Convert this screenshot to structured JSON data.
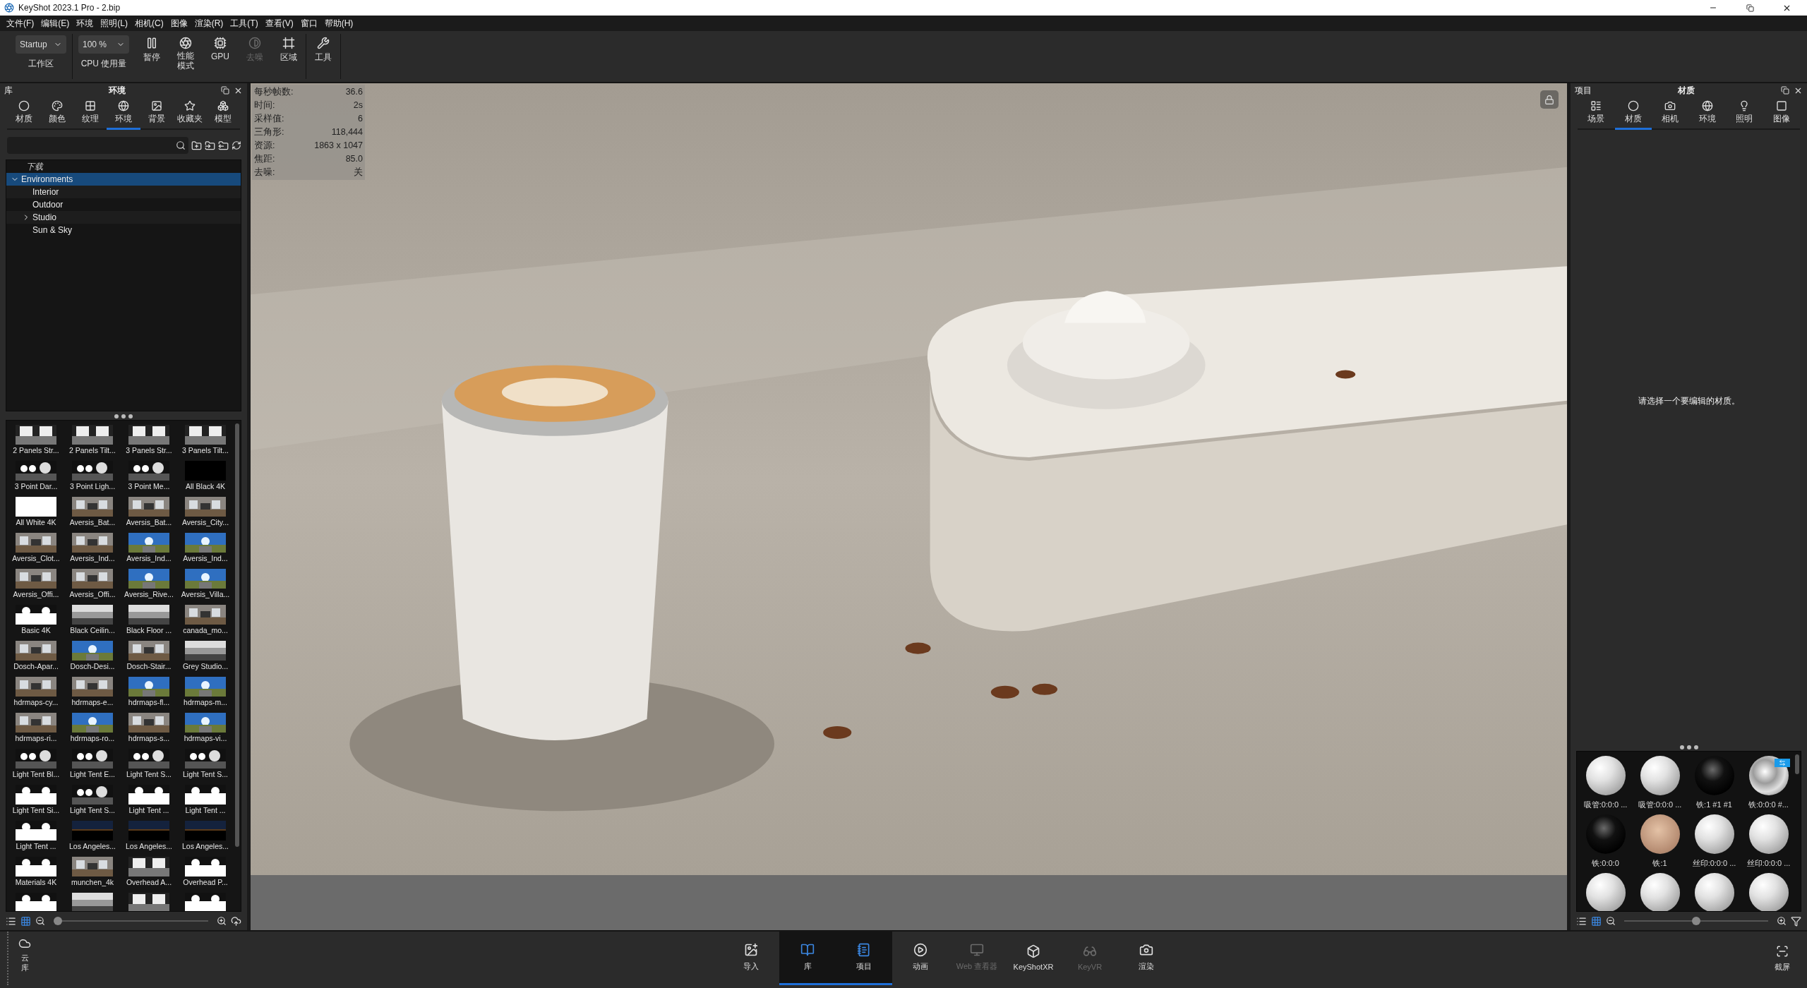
{
  "window": {
    "title": "KeyShot 2023.1 Pro  - 2.bip"
  },
  "menu": [
    "文件(F)",
    "编辑(E)",
    "环境",
    "照明(L)",
    "相机(C)",
    "图像",
    "渲染(R)",
    "工具(T)",
    "查看(V)",
    "窗口",
    "帮助(H)"
  ],
  "toolbar": [
    {
      "kind": "dropdown",
      "value": "Startup",
      "label": "工作区"
    },
    {
      "kind": "dropdown",
      "value": "100 %",
      "label": "CPU 使用量"
    },
    {
      "kind": "button",
      "label": "暂停",
      "disabled": false
    },
    {
      "kind": "button",
      "label": "性能模式",
      "disabled": false
    },
    {
      "kind": "button",
      "label": "GPU",
      "disabled": false
    },
    {
      "kind": "button",
      "label": "去噪",
      "disabled": true
    },
    {
      "kind": "button",
      "label": "区域",
      "disabled": false
    },
    {
      "kind": "button",
      "label": "工具",
      "disabled": false
    }
  ],
  "library": {
    "title": "库",
    "subtitle": "环境",
    "tabs": [
      {
        "label": "材质",
        "selected": false
      },
      {
        "label": "颜色",
        "selected": false
      },
      {
        "label": "纹理",
        "selected": false
      },
      {
        "label": "环境",
        "selected": true
      },
      {
        "label": "背景",
        "selected": false
      },
      {
        "label": "收藏夹",
        "selected": false
      },
      {
        "label": "模型",
        "selected": false
      }
    ],
    "tree_header": "下载",
    "tree": [
      {
        "label": "Environments",
        "selected": true,
        "expanded": true,
        "children": [
          {
            "label": "Interior",
            "selected": false
          },
          {
            "label": "Outdoor",
            "selected": false
          },
          {
            "label": "Studio",
            "selected": false,
            "expanded": false
          },
          {
            "label": "Sun & Sky",
            "selected": false
          }
        ]
      }
    ],
    "thumbnails": [
      {
        "label": "2 Panels Str...",
        "kind": "panels"
      },
      {
        "label": "2 Panels Tilt...",
        "kind": "panels"
      },
      {
        "label": "3 Panels Str...",
        "kind": "panels"
      },
      {
        "label": "3 Panels Tilt...",
        "kind": "panels"
      },
      {
        "label": "3 Point Dar...",
        "kind": "spots"
      },
      {
        "label": "3 Point Ligh...",
        "kind": "spots"
      },
      {
        "label": "3 Point Me...",
        "kind": "spots"
      },
      {
        "label": "All Black 4K",
        "kind": "black"
      },
      {
        "label": "All White 4K",
        "kind": "white"
      },
      {
        "label": "Aversis_Bat...",
        "kind": "interior"
      },
      {
        "label": "Aversis_Bat...",
        "kind": "interior"
      },
      {
        "label": "Aversis_City...",
        "kind": "interior"
      },
      {
        "label": "Aversis_Clot...",
        "kind": "interior"
      },
      {
        "label": "Aversis_Ind...",
        "kind": "interior"
      },
      {
        "label": "Aversis_Ind...",
        "kind": "outdoor"
      },
      {
        "label": "Aversis_Ind...",
        "kind": "outdoor"
      },
      {
        "label": "Aversis_Offi...",
        "kind": "interior"
      },
      {
        "label": "Aversis_Offi...",
        "kind": "interior"
      },
      {
        "label": "Aversis_Rive...",
        "kind": "outdoor"
      },
      {
        "label": "Aversis_Villa...",
        "kind": "outdoor"
      },
      {
        "label": "Basic 4K",
        "kind": "tent"
      },
      {
        "label": "Black Ceilin...",
        "kind": "gradient"
      },
      {
        "label": "Black Floor ...",
        "kind": "gradient"
      },
      {
        "label": "canada_mo...",
        "kind": "interior"
      },
      {
        "label": "Dosch-Apar...",
        "kind": "interior"
      },
      {
        "label": "Dosch-Desi...",
        "kind": "outdoor"
      },
      {
        "label": "Dosch-Stair...",
        "kind": "interior"
      },
      {
        "label": "Grey Studio...",
        "kind": "gradient"
      },
      {
        "label": "hdrmaps-cy...",
        "kind": "interior"
      },
      {
        "label": "hdrmaps-e...",
        "kind": "interior"
      },
      {
        "label": "hdrmaps-fl...",
        "kind": "outdoor"
      },
      {
        "label": "hdrmaps-m...",
        "kind": "outdoor"
      },
      {
        "label": "hdrmaps-ri...",
        "kind": "interior"
      },
      {
        "label": "hdrmaps-ro...",
        "kind": "outdoor"
      },
      {
        "label": "hdrmaps-s...",
        "kind": "interior"
      },
      {
        "label": "hdrmaps-vi...",
        "kind": "outdoor"
      },
      {
        "label": "Light Tent Bl...",
        "kind": "spots"
      },
      {
        "label": "Light Tent E...",
        "kind": "spots"
      },
      {
        "label": "Light Tent S...",
        "kind": "spots"
      },
      {
        "label": "Light Tent S...",
        "kind": "spots"
      },
      {
        "label": "Light Tent Si...",
        "kind": "tent"
      },
      {
        "label": "Light Tent S...",
        "kind": "spots"
      },
      {
        "label": "Light Tent ...",
        "kind": "tent"
      },
      {
        "label": "Light Tent ...",
        "kind": "tent"
      },
      {
        "label": "Light Tent ...",
        "kind": "tent"
      },
      {
        "label": "Los Angeles...",
        "kind": "night"
      },
      {
        "label": "Los Angeles...",
        "kind": "night"
      },
      {
        "label": "Los Angeles...",
        "kind": "night"
      },
      {
        "label": "Materials 4K",
        "kind": "tent"
      },
      {
        "label": "munchen_4k",
        "kind": "interior"
      },
      {
        "label": "Overhead A...",
        "kind": "panels"
      },
      {
        "label": "Overhead P...",
        "kind": "tent"
      },
      {
        "kind": "tent"
      },
      {
        "kind": "gradient"
      },
      {
        "kind": "panels"
      },
      {
        "kind": "tent"
      }
    ],
    "zoom_slider": {
      "level": 0
    }
  },
  "viewport": {
    "stats": [
      {
        "label": "每秒帧数:",
        "value": "36.6"
      },
      {
        "label": "时间:",
        "value": "2s"
      },
      {
        "label": "采样值:",
        "value": "6"
      },
      {
        "label": "三角形:",
        "value": "118,444"
      },
      {
        "label": "资源:",
        "value": "1863 x 1047"
      },
      {
        "label": "焦距:",
        "value": "85.0"
      },
      {
        "label": "去噪:",
        "value": "关"
      }
    ]
  },
  "project": {
    "title": "项目",
    "subtitle": "材质",
    "tabs": [
      {
        "label": "场景",
        "selected": false
      },
      {
        "label": "材质",
        "selected": true
      },
      {
        "label": "相机",
        "selected": false
      },
      {
        "label": "环境",
        "selected": false
      },
      {
        "label": "照明",
        "selected": false
      },
      {
        "label": "图像",
        "selected": false
      }
    ],
    "message": "请选择一个要编辑的材质。",
    "materials": [
      {
        "label": "吸管:0:0:0 ...",
        "kind": "white",
        "linked": false
      },
      {
        "label": "吸管:0:0:0 ...",
        "kind": "white",
        "linked": false
      },
      {
        "label": "铁:1 #1 #1",
        "kind": "black",
        "linked": false
      },
      {
        "label": "铁:0:0:0 #...",
        "kind": "chrome",
        "linked": true
      },
      {
        "label": "铁:0:0:0",
        "kind": "black",
        "linked": false
      },
      {
        "label": "铁:1",
        "kind": "skin",
        "linked": false
      },
      {
        "label": "丝印:0:0:0 ...",
        "kind": "white",
        "linked": false
      },
      {
        "label": "丝印:0:0:0 ...",
        "kind": "white",
        "linked": false
      },
      {
        "kind": "white",
        "linked": false
      },
      {
        "kind": "white",
        "linked": false
      },
      {
        "kind": "white",
        "linked": false
      },
      {
        "kind": "white",
        "linked": false
      }
    ],
    "zoom_slider": {
      "level": 0.5
    }
  },
  "bottom_bar": {
    "cloud": "云库",
    "buttons": [
      {
        "label": "导入",
        "selected": false,
        "disabled": false
      },
      {
        "label": "库",
        "selected": true,
        "disabled": false
      },
      {
        "label": "项目",
        "selected": true,
        "disabled": false
      },
      {
        "label": "动画",
        "selected": false,
        "disabled": false
      },
      {
        "label": "Web 查看器",
        "selected": false,
        "disabled": true
      },
      {
        "label": "KeyShotXR",
        "selected": false,
        "disabled": false
      },
      {
        "label": "KeyVR",
        "selected": false,
        "disabled": true
      },
      {
        "label": "渲染",
        "selected": false,
        "disabled": false
      }
    ],
    "screenshot": "截屏"
  }
}
